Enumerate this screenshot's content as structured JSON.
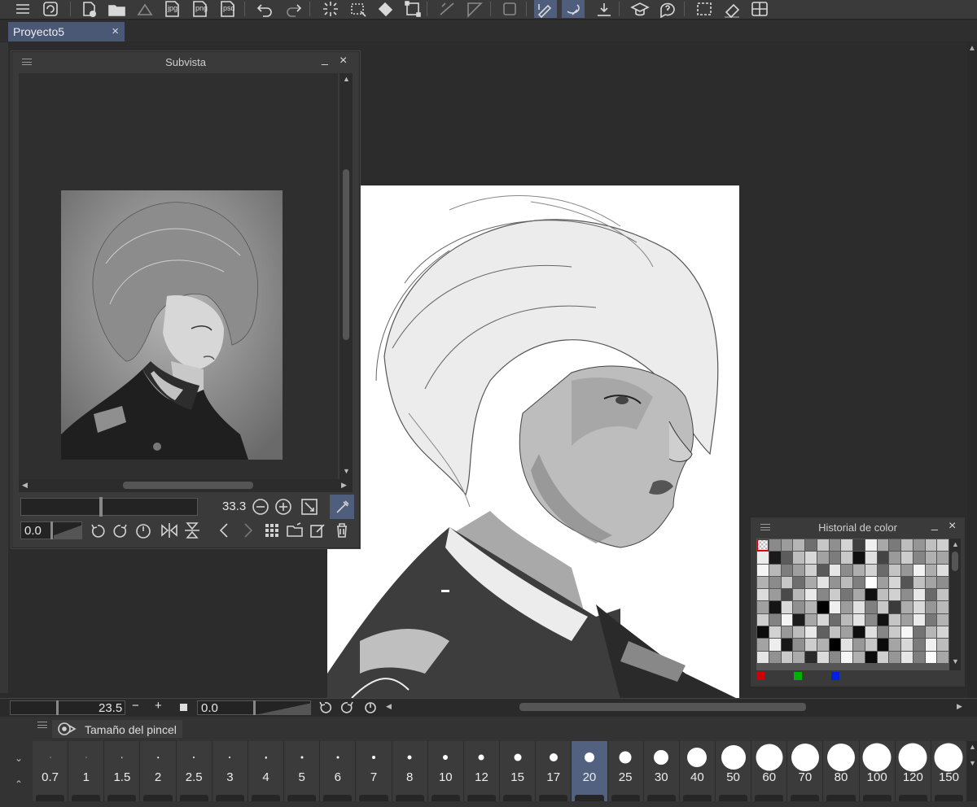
{
  "toolbar": {
    "buttons": [
      {
        "name": "menu-icon"
      },
      {
        "name": "clip-logo-icon"
      },
      {
        "name": "new-file-icon"
      },
      {
        "name": "open-folder-icon"
      },
      {
        "name": "save-icon"
      },
      {
        "name": "export-jpg-icon",
        "label": "jpg"
      },
      {
        "name": "export-png-icon",
        "label": "png"
      },
      {
        "name": "export-psd-icon",
        "label": "psd"
      },
      {
        "name": "undo-icon"
      },
      {
        "name": "redo-icon"
      },
      {
        "name": "spinner-icon"
      },
      {
        "name": "transform-icon"
      },
      {
        "name": "fill-bucket-icon"
      },
      {
        "name": "selection-icon"
      },
      {
        "name": "ruler-icon"
      },
      {
        "name": "ruler-2-icon"
      },
      {
        "name": "layer-icon"
      },
      {
        "name": "pen-sync-icon"
      },
      {
        "name": "lasso-pen-icon"
      },
      {
        "name": "layer-down-icon"
      },
      {
        "name": "learn-icon"
      },
      {
        "name": "help-icon"
      },
      {
        "name": "select-box-icon"
      },
      {
        "name": "eraser-icon"
      },
      {
        "name": "grid-icon"
      }
    ]
  },
  "tab": {
    "label": "Proyecto5",
    "close": "×"
  },
  "subvista": {
    "title": "Subvista",
    "minimize": "_",
    "close": "×",
    "zoom_value": "33.3",
    "rotation_value": "0.0"
  },
  "color_history": {
    "title": "Historial de color",
    "minimize": "_",
    "close": "×",
    "swatches": [
      "#ffffff",
      "#8a8a8a",
      "#9c9c9c",
      "#b5b5b5",
      "#6f6f6f",
      "#c7c7c7",
      "#8f8f8f",
      "#d4d4d4",
      "#3e3e3e",
      "#f0f0f0",
      "#a8a8a8",
      "#7a7a7a",
      "#bdbdbd",
      "#959595",
      "#c0c0c0",
      "#cfcfcf",
      "#ececec",
      "#1a1a1a",
      "#5c5c5c",
      "#bdbdbd",
      "#d8d8d8",
      "#a2a2a2",
      "#7c7c7c",
      "#c9c9c9",
      "#111111",
      "#e0e0e0",
      "#444444",
      "#9a9a9a",
      "#cccccc",
      "#858585",
      "#b0b0b0",
      "#a6a6a6",
      "#f5f5f5",
      "#b8b8b8",
      "#7d7d7d",
      "#9f9f9f",
      "#d0d0d0",
      "#595959",
      "#e6e6e6",
      "#8c8c8c",
      "#aeaeae",
      "#d3d3d3",
      "#6a6a6a",
      "#c4c4c4",
      "#979797",
      "#f2f2f2",
      "#adadad",
      "#dedede",
      "#b2b2b2",
      "#8b8b8b",
      "#c6c6c6",
      "#6e6e6e",
      "#aaaaaa",
      "#e3e3e3",
      "#939393",
      "#bbbbbb",
      "#7f7f7f",
      "#ffffff",
      "#9e9e9e",
      "#d6d6d6",
      "#555555",
      "#c1c1c1",
      "#a4a4a4",
      "#8e8e8e",
      "#dcdcdc",
      "#9b9b9b",
      "#4a4a4a",
      "#b7b7b7",
      "#e9e9e9",
      "#878787",
      "#cbcbcb",
      "#767676",
      "#a9a9a9",
      "#101010",
      "#bfbfbf",
      "#d1d1d1",
      "#8d8d8d",
      "#e7e7e7",
      "#696969",
      "#c3c3c3",
      "#a1a1a1",
      "#151515",
      "#d9d9d9",
      "#909090",
      "#b4b4b4",
      "#000000",
      "#efefef",
      "#9d9d9d",
      "#e1e1e1",
      "#808080",
      "#c8c8c8",
      "#3b3b3b",
      "#adadad",
      "#dadada",
      "#969696",
      "#b9b9b9",
      "#cecece",
      "#828282",
      "#f4f4f4",
      "#1c1c1c",
      "#a7a7a7",
      "#d7d7d7",
      "#6c6c6c",
      "#bababa",
      "#e4e4e4",
      "#8a8a8a",
      "#121212",
      "#c5c5c5",
      "#9f9f9f",
      "#ebebeb",
      "#787878",
      "#b3b3b3",
      "#0c0c0c",
      "#d2d2d2",
      "#999999",
      "#bcbcbc",
      "#e8e8e8",
      "#606060",
      "#c2c2c2",
      "#a0a0a0",
      "#0e0e0e",
      "#dfdfdf",
      "#868686",
      "#cacaca",
      "#f7f7f7",
      "#737373",
      "#b6b6b6",
      "#d5d5d5",
      "#a3a3a3",
      "#ededed",
      "#181818",
      "#8f8f8f",
      "#cdcdcd",
      "#b1b1b1",
      "#000000",
      "#e2e2e2",
      "#989898",
      "#c6c6c6",
      "#0a0a0a",
      "#a5a5a5",
      "#d8d8d8",
      "#7b7b7b",
      "#f1f1f1",
      "#bcbcbc",
      "#e5e5e5",
      "#929292",
      "#c9c9c9",
      "#ababab",
      "#2a2a2a",
      "#dbdbdb",
      "#888888",
      "#f6f6f6",
      "#b0b0b0",
      "#0b0b0b",
      "#cfcfcf",
      "#969696",
      "#e6e6e6",
      "#7e7e7e",
      "#ffffff",
      "#a8a8a8"
    ],
    "rgb_marks": [
      "#d00000",
      "#00b000",
      "#0020e0"
    ]
  },
  "statusbar": {
    "zoom_value": "23.5",
    "minus": "−",
    "plus": "+",
    "rotation_value": "0.0"
  },
  "brush_palette": {
    "tab_label": "Tamaño del pincel",
    "selected": "20",
    "sizes": [
      {
        "label": "0.7",
        "dot": 1
      },
      {
        "label": "1",
        "dot": 1
      },
      {
        "label": "1.5",
        "dot": 1.5
      },
      {
        "label": "2",
        "dot": 1.5
      },
      {
        "label": "2.5",
        "dot": 2
      },
      {
        "label": "3",
        "dot": 2
      },
      {
        "label": "4",
        "dot": 2.5
      },
      {
        "label": "5",
        "dot": 3
      },
      {
        "label": "6",
        "dot": 3
      },
      {
        "label": "7",
        "dot": 4
      },
      {
        "label": "8",
        "dot": 5
      },
      {
        "label": "10",
        "dot": 6
      },
      {
        "label": "12",
        "dot": 7
      },
      {
        "label": "15",
        "dot": 9
      },
      {
        "label": "17",
        "dot": 10
      },
      {
        "label": "20",
        "dot": 12
      },
      {
        "label": "25",
        "dot": 15
      },
      {
        "label": "30",
        "dot": 18
      },
      {
        "label": "40",
        "dot": 24
      },
      {
        "label": "50",
        "dot": 30
      },
      {
        "label": "60",
        "dot": 33
      },
      {
        "label": "70",
        "dot": 34
      },
      {
        "label": "80",
        "dot": 34
      },
      {
        "label": "100",
        "dot": 35
      },
      {
        "label": "120",
        "dot": 35
      },
      {
        "label": "150",
        "dot": 35
      }
    ]
  }
}
